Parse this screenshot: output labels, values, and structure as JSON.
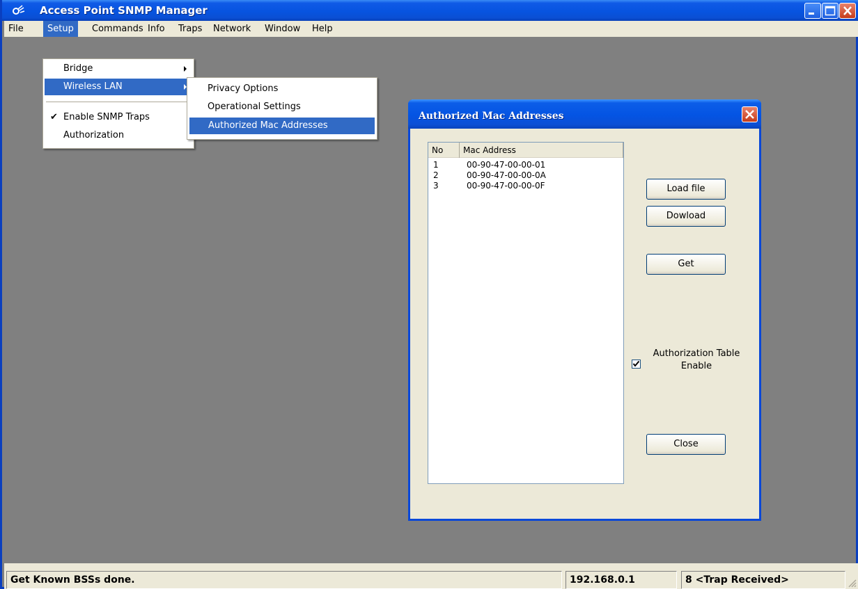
{
  "window": {
    "title": "Access Point SNMP Manager"
  },
  "menubar": [
    "File",
    "Setup",
    "Commands",
    "Info",
    "Traps",
    "Network",
    "Window",
    "Help"
  ],
  "setup_menu": {
    "bridge": "Bridge",
    "wireless_lan": "Wireless LAN",
    "enable_snmp_traps": "Enable SNMP Traps",
    "authorization": "Authorization"
  },
  "wireless_menu": [
    "Privacy Options",
    "Operational Settings",
    "Authorized Mac Addresses"
  ],
  "dialog": {
    "title": "Authorized Mac Addresses",
    "columns": [
      "No",
      "Mac Address"
    ],
    "rows": [
      {
        "no": "1",
        "mac": "00-90-47-00-00-01"
      },
      {
        "no": "2",
        "mac": "00-90-47-00-00-0A"
      },
      {
        "no": "3",
        "mac": "00-90-47-00-00-0F"
      }
    ],
    "load_file": "Load file",
    "download": "Dowload",
    "get": "Get",
    "auth_table_enable": "Authorization Table Enable",
    "auth_table_checked": true,
    "close": "Close"
  },
  "status": {
    "message": "Get Known BSSs done.",
    "ip": "192.168.0.1",
    "traps": "8 <Trap Received>"
  }
}
